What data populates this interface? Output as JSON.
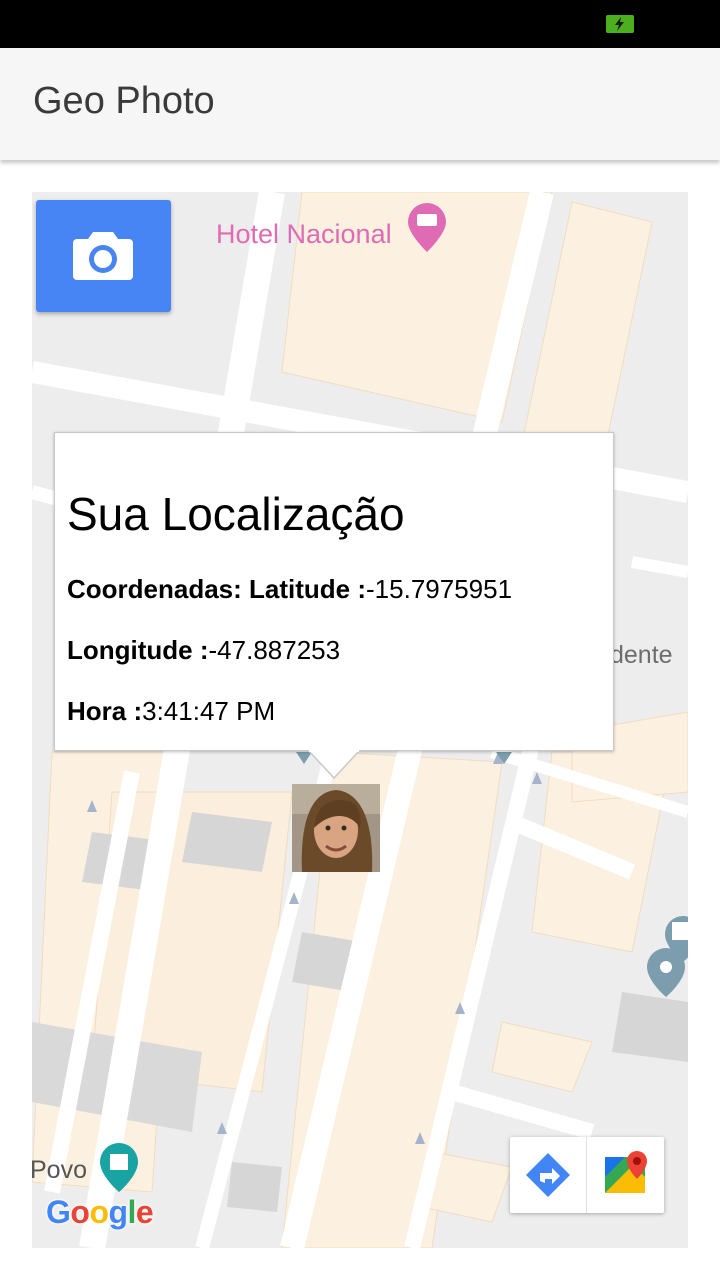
{
  "app": {
    "title": "Geo Photo"
  },
  "map": {
    "labels": {
      "hotel": "Hotel Nacional",
      "dente": "dente",
      "povo": "Povo"
    },
    "attribution": {
      "google_letters": [
        "G",
        "o",
        "o",
        "g",
        "l",
        "e"
      ],
      "google_colors": [
        "#4285f4",
        "#ea4335",
        "#fbbc05",
        "#4285f4",
        "#34a853",
        "#ea4335"
      ]
    }
  },
  "camera_button": {
    "icon": "camera-icon",
    "color": "#4885f4"
  },
  "info_window": {
    "heading": "Sua Localização",
    "latitude_label": "Coordenadas: Latitude :",
    "latitude_value": "-15.7975951",
    "longitude_label": "Longitude :",
    "longitude_value": "-47.887253",
    "time_label": "Hora :",
    "time_value": "3:41:47 PM"
  },
  "marker": {
    "icon": "user-photo-avatar"
  },
  "toolbar": {
    "directions_icon": "directions-icon",
    "maps_icon": "google-maps-icon"
  },
  "status_bar": {
    "battery_icon": "battery-charging-icon"
  }
}
